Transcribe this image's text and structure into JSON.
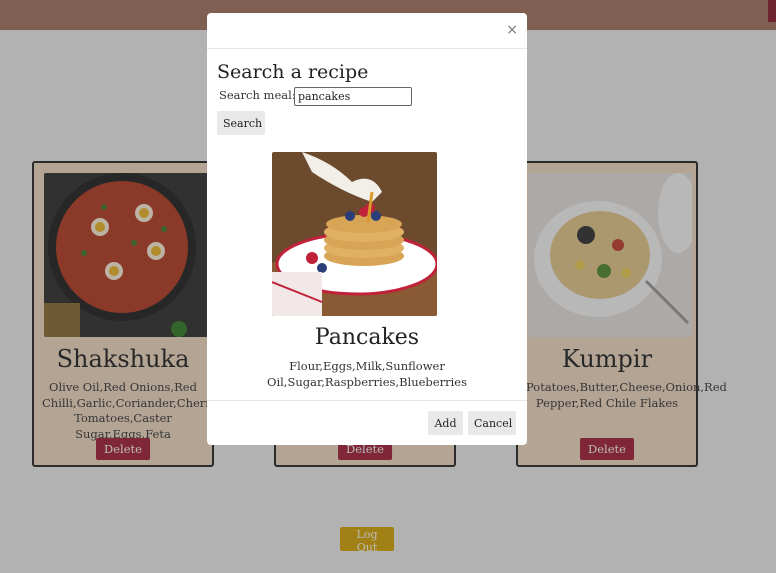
{
  "recipes": [
    {
      "title": "Shakshuka",
      "ingredients": "Olive Oil,Red Onions,Red Chilli,Garlic,Coriander,Cherry Tomatoes,Caster Sugar,Eggs,Feta",
      "delete_label": "Delete"
    },
    {
      "title": "",
      "ingredients": "",
      "delete_label": "Delete"
    },
    {
      "title": "Kumpir",
      "ingredients": "Potatoes,Butter,Cheese,Onion,Red Pepper,Red Chile Flakes",
      "delete_label": "Delete"
    }
  ],
  "logout_label": "Log Out",
  "modal": {
    "close_glyph": "×",
    "heading": "Search a recipe",
    "search_label": "Search meal:",
    "search_value": "pancakes",
    "search_button": "Search",
    "result": {
      "title": "Pancakes",
      "ingredients": "Flour,Eggs,Milk,Sunflower Oil,Sugar,Raspberries,Blueberries"
    },
    "add_button": "Add",
    "cancel_button": "Cancel"
  },
  "colors": {
    "topbar": "#a3725f",
    "card_bg": "#f3dcc4",
    "delete": "#a31d36",
    "logout": "#d7a500"
  }
}
